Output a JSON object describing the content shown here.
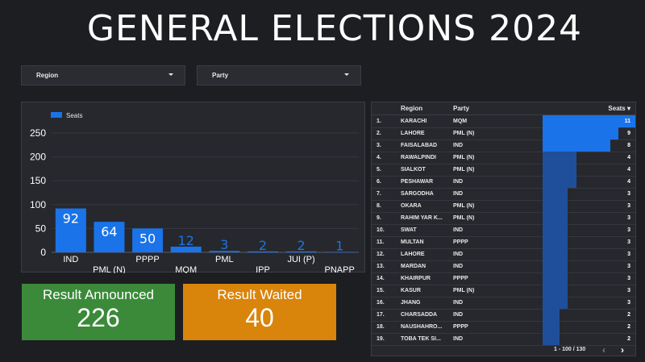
{
  "header": {
    "title": "GENERAL ELECTIONS 2024"
  },
  "filters": {
    "region_label": "Region",
    "party_label": "Party"
  },
  "colors": {
    "bar": "#1a73e8",
    "announced": "#3b8a3a",
    "waited": "#d9840b",
    "table_bar_top": "#1a73e8",
    "table_bar": "#1f4f9a"
  },
  "chart_data": {
    "type": "bar",
    "categories": [
      "IND",
      "PML (N)",
      "PPPP",
      "MQM",
      "PML",
      "IPP",
      "JUI (P)",
      "PNAPP"
    ],
    "values": [
      92,
      64,
      50,
      12,
      3,
      2,
      2,
      1
    ],
    "legend": [
      "Seats"
    ],
    "ylim": [
      0,
      250
    ],
    "yticks": [
      "0",
      "50",
      "100",
      "150",
      "200",
      "250"
    ],
    "grid": true,
    "legend_position": "top-left"
  },
  "cards": {
    "announced": {
      "label": "Result Announced",
      "value": "226"
    },
    "waited": {
      "label": "Result Waited",
      "value": "40"
    }
  },
  "table": {
    "headers": {
      "region": "Region",
      "party": "Party",
      "seats": "Seats ▾"
    },
    "rows": [
      {
        "idx": "1.",
        "region": "KARACHI",
        "party": "MQM",
        "seats": 11
      },
      {
        "idx": "2.",
        "region": "LAHORE",
        "party": "PML (N)",
        "seats": 9
      },
      {
        "idx": "3.",
        "region": "FAISALABAD",
        "party": "IND",
        "seats": 8
      },
      {
        "idx": "4.",
        "region": "RAWALPINDI",
        "party": "PML (N)",
        "seats": 4
      },
      {
        "idx": "5.",
        "region": "SIALKOT",
        "party": "PML (N)",
        "seats": 4
      },
      {
        "idx": "6.",
        "region": "PESHAWAR",
        "party": "IND",
        "seats": 4
      },
      {
        "idx": "7.",
        "region": "SARGODHA",
        "party": "IND",
        "seats": 3
      },
      {
        "idx": "8.",
        "region": "OKARA",
        "party": "PML (N)",
        "seats": 3
      },
      {
        "idx": "9.",
        "region": "RAHIM YAR K...",
        "party": "PML (N)",
        "seats": 3
      },
      {
        "idx": "10.",
        "region": "SWAT",
        "party": "IND",
        "seats": 3
      },
      {
        "idx": "11.",
        "region": "MULTAN",
        "party": "PPPP",
        "seats": 3
      },
      {
        "idx": "12.",
        "region": "LAHORE",
        "party": "IND",
        "seats": 3
      },
      {
        "idx": "13.",
        "region": "MARDAN",
        "party": "IND",
        "seats": 3
      },
      {
        "idx": "14.",
        "region": "KHAIRPUR",
        "party": "PPPP",
        "seats": 3
      },
      {
        "idx": "15.",
        "region": "KASUR",
        "party": "PML (N)",
        "seats": 3
      },
      {
        "idx": "16.",
        "region": "JHANG",
        "party": "IND",
        "seats": 3
      },
      {
        "idx": "17.",
        "region": "CHARSADDA",
        "party": "IND",
        "seats": 2
      },
      {
        "idx": "18.",
        "region": "NAUSHAHRO...",
        "party": "PPPP",
        "seats": 2
      },
      {
        "idx": "19.",
        "region": "TOBA TEK SI...",
        "party": "IND",
        "seats": 2
      }
    ],
    "pagination": {
      "text": "1 - 100 / 130",
      "prev": "‹",
      "next": "›"
    }
  }
}
